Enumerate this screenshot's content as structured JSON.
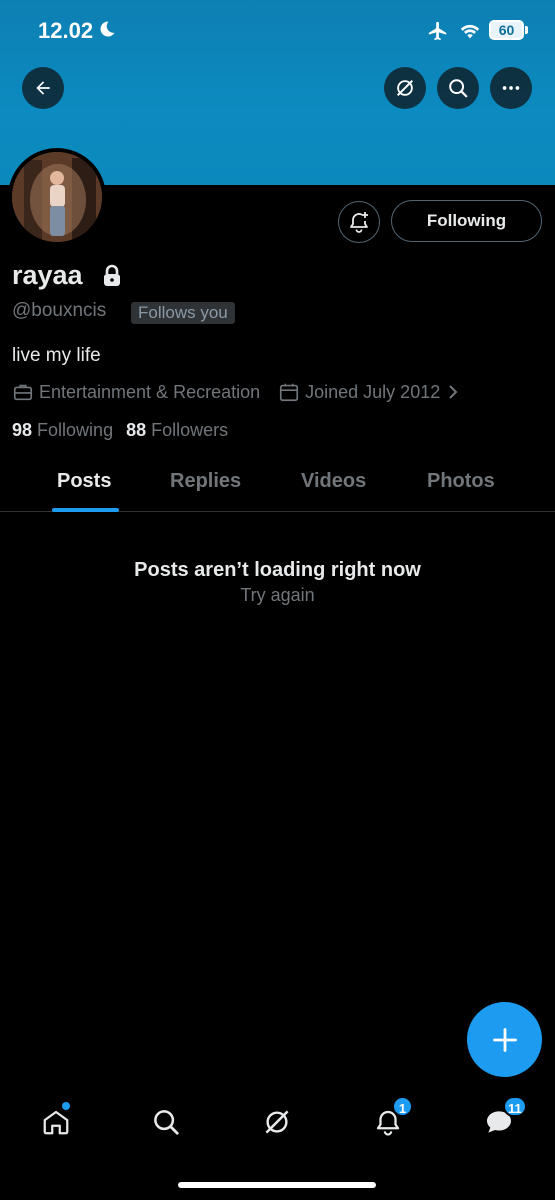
{
  "status_bar": {
    "time": "12.02",
    "battery": "60"
  },
  "profile": {
    "display_name": "rayaa",
    "handle": "@bouxncis",
    "follows_badge": "Follows you",
    "bio": "live my life",
    "category": "Entertainment & Recreation",
    "joined": "Joined July 2012",
    "following_count": "98",
    "following_label": "Following",
    "followers_count": "88",
    "followers_label": "Followers",
    "following_button": "Following"
  },
  "tabs": [
    {
      "label": "Posts",
      "active": true
    },
    {
      "label": "Replies",
      "active": false
    },
    {
      "label": "Videos",
      "active": false
    },
    {
      "label": "Photos",
      "active": false
    }
  ],
  "feed": {
    "error_title": "Posts aren’t loading right now",
    "retry_label": "Try again"
  },
  "bottom_nav": {
    "items": [
      {
        "icon": "home-icon"
      },
      {
        "icon": "search-icon"
      },
      {
        "icon": "grok-icon"
      },
      {
        "icon": "bell-icon",
        "badge": "1"
      },
      {
        "icon": "messages-icon",
        "badge": "11"
      }
    ]
  },
  "colors": {
    "accent": "#1d9bf0",
    "banner": "#0c8bc0",
    "background": "#000000",
    "muted_text": "#71767b"
  }
}
